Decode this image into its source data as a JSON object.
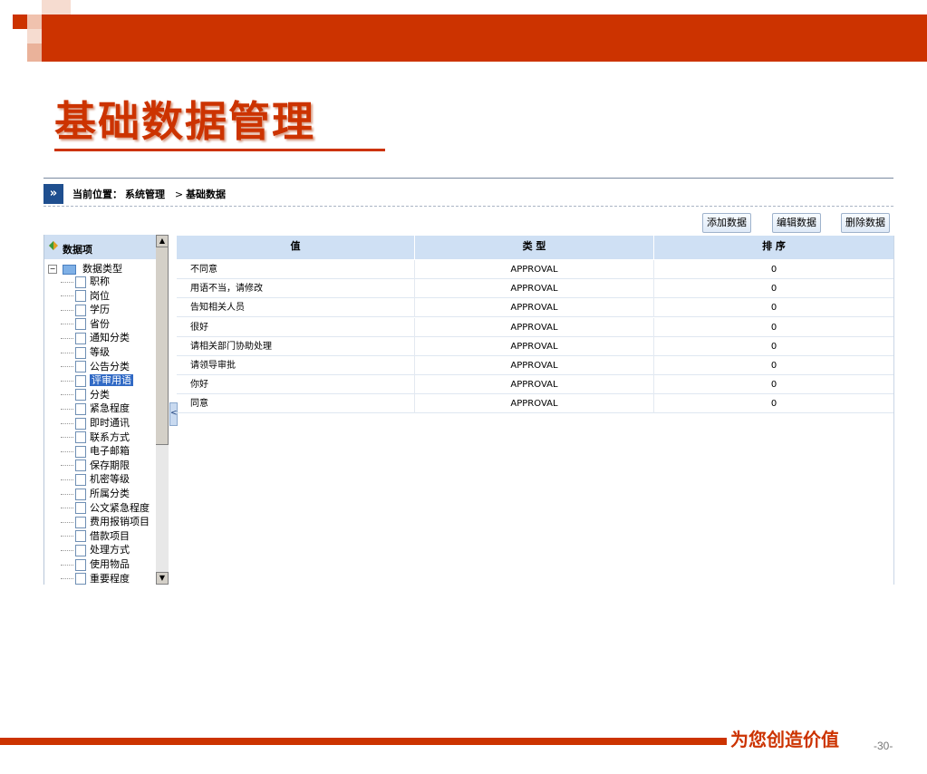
{
  "slide": {
    "title": "基础数据管理",
    "slogan": "为您创造价值",
    "page_number": "-30-",
    "accent_color": "#cc3300"
  },
  "breadcrumb": {
    "icon": "double-chevron-right-icon",
    "prefix": "当前位置：",
    "path": "系统管理",
    "separator": ">",
    "current": "基础数据"
  },
  "toolbar": {
    "add_label": "添加数据",
    "edit_label": "编辑数据",
    "delete_label": "删除数据"
  },
  "tree": {
    "header": "数据项",
    "root": "数据类型",
    "items": [
      {
        "label": "职称"
      },
      {
        "label": "岗位"
      },
      {
        "label": "学历"
      },
      {
        "label": "省份"
      },
      {
        "label": "通知分类"
      },
      {
        "label": "等级"
      },
      {
        "label": "公告分类"
      },
      {
        "label": "评审用语",
        "selected": true
      },
      {
        "label": "分类"
      },
      {
        "label": "紧急程度"
      },
      {
        "label": "即时通讯"
      },
      {
        "label": "联系方式"
      },
      {
        "label": "电子邮箱"
      },
      {
        "label": "保存期限"
      },
      {
        "label": "机密等级"
      },
      {
        "label": "所属分类"
      },
      {
        "label": "公文紧急程度"
      },
      {
        "label": "费用报销项目"
      },
      {
        "label": "借款项目"
      },
      {
        "label": "处理方式"
      },
      {
        "label": "使用物品"
      },
      {
        "label": "重要程度"
      }
    ]
  },
  "table": {
    "columns": [
      "值",
      "类 型",
      "排 序"
    ],
    "rows": [
      {
        "value": "不同意",
        "type": "APPROVAL",
        "order": "0"
      },
      {
        "value": "用语不当，请修改",
        "type": "APPROVAL",
        "order": "0"
      },
      {
        "value": "告知相关人员",
        "type": "APPROVAL",
        "order": "0"
      },
      {
        "value": "很好",
        "type": "APPROVAL",
        "order": "0"
      },
      {
        "value": "请相关部门协助处理",
        "type": "APPROVAL",
        "order": "0"
      },
      {
        "value": "请领导审批",
        "type": "APPROVAL",
        "order": "0"
      },
      {
        "value": "你好",
        "type": "APPROVAL",
        "order": "0"
      },
      {
        "value": "同意",
        "type": "APPROVAL",
        "order": "0"
      }
    ]
  }
}
